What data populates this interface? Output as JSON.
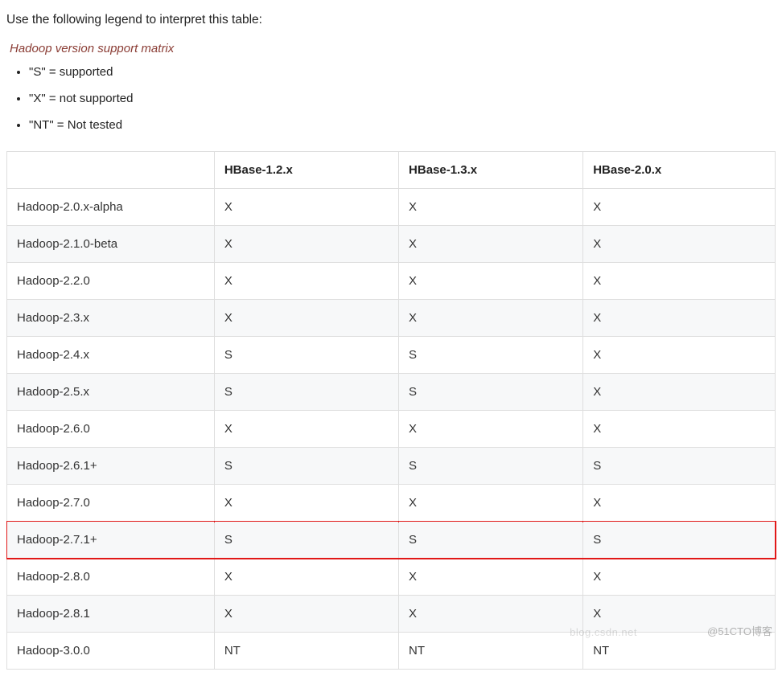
{
  "intro": "Use the following legend to interpret this table:",
  "legendTitle": "Hadoop version support matrix",
  "legendItems": [
    "\"S\" = supported",
    "\"X\" = not supported",
    "\"NT\" = Not tested"
  ],
  "columns": [
    "",
    "HBase-1.2.x",
    "HBase-1.3.x",
    "HBase-2.0.x"
  ],
  "rows": [
    {
      "label": "Hadoop-2.0.x-alpha",
      "cells": [
        "X",
        "X",
        "X"
      ],
      "highlight": false
    },
    {
      "label": "Hadoop-2.1.0-beta",
      "cells": [
        "X",
        "X",
        "X"
      ],
      "highlight": false
    },
    {
      "label": "Hadoop-2.2.0",
      "cells": [
        "X",
        "X",
        "X"
      ],
      "highlight": false
    },
    {
      "label": "Hadoop-2.3.x",
      "cells": [
        "X",
        "X",
        "X"
      ],
      "highlight": false
    },
    {
      "label": "Hadoop-2.4.x",
      "cells": [
        "S",
        "S",
        "X"
      ],
      "highlight": false
    },
    {
      "label": "Hadoop-2.5.x",
      "cells": [
        "S",
        "S",
        "X"
      ],
      "highlight": false
    },
    {
      "label": "Hadoop-2.6.0",
      "cells": [
        "X",
        "X",
        "X"
      ],
      "highlight": false
    },
    {
      "label": "Hadoop-2.6.1+",
      "cells": [
        "S",
        "S",
        "S"
      ],
      "highlight": false
    },
    {
      "label": "Hadoop-2.7.0",
      "cells": [
        "X",
        "X",
        "X"
      ],
      "highlight": false
    },
    {
      "label": "Hadoop-2.7.1+",
      "cells": [
        "S",
        "S",
        "S"
      ],
      "highlight": true
    },
    {
      "label": "Hadoop-2.8.0",
      "cells": [
        "X",
        "X",
        "X"
      ],
      "highlight": false
    },
    {
      "label": "Hadoop-2.8.1",
      "cells": [
        "X",
        "X",
        "X"
      ],
      "highlight": false
    },
    {
      "label": "Hadoop-3.0.0",
      "cells": [
        "NT",
        "NT",
        "NT"
      ],
      "highlight": false
    }
  ],
  "watermark": "@51CTO博客",
  "watermarkFaint": "blog.csdn.net"
}
